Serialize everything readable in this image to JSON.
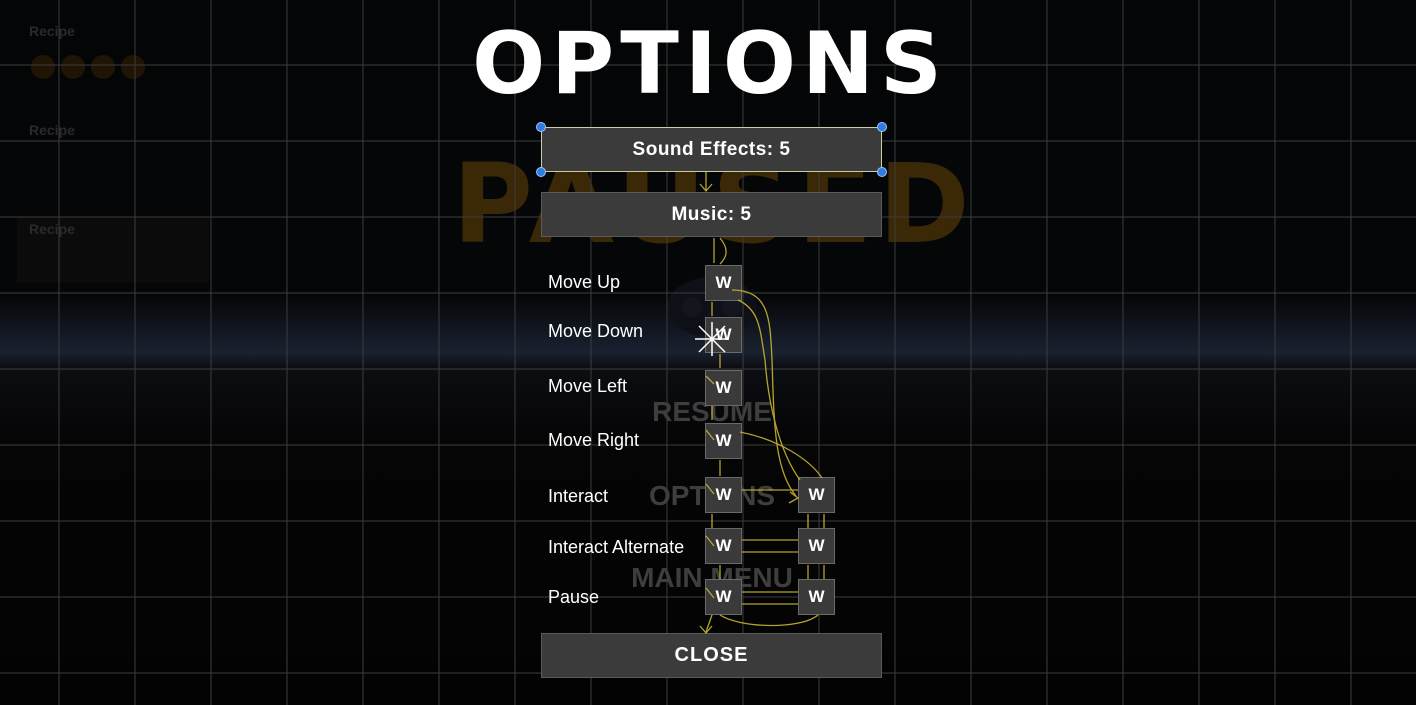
{
  "background": {
    "recipes": [
      {
        "title": "Recipe",
        "icons": [
          "ingredient-icon",
          "ingredient-icon",
          "ingredient-icon",
          "ingredient-icon"
        ]
      },
      {
        "title": "Recipe"
      },
      {
        "title": "Recipe"
      }
    ],
    "paused_title": "PAUSED",
    "pause_menu": {
      "resume": "RESUME",
      "options": "OPTIONS",
      "main_menu": "MAIN MENU"
    }
  },
  "options": {
    "title": "OPTIONS",
    "sound_effects": "Sound Effects: 5",
    "music": "Music: 5",
    "close": "CLOSE",
    "bindings": [
      {
        "label": "Move Up",
        "primary": "W"
      },
      {
        "label": "Move Down",
        "primary": "W"
      },
      {
        "label": "Move Left",
        "primary": "W"
      },
      {
        "label": "Move Right",
        "primary": "W"
      },
      {
        "label": "Interact",
        "primary": "W",
        "secondary": "W"
      },
      {
        "label": "Interact Alternate",
        "primary": "W",
        "secondary": "W"
      },
      {
        "label": "Pause",
        "primary": "W",
        "secondary": "W"
      }
    ]
  },
  "colors": {
    "paused_text": "#3a2806",
    "selection_handle": "#2f7de0",
    "nav_arrow": "#c9b532",
    "button_fill": "#3b3b3b"
  }
}
